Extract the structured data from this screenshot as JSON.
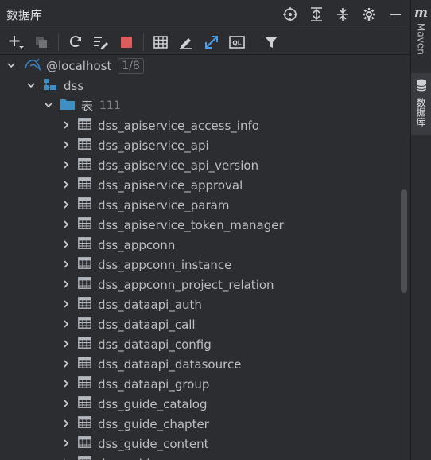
{
  "panel": {
    "title": "数据库"
  },
  "icons": {
    "locate": "crosshair-icon",
    "expand_all": "expand-all-icon",
    "collapse_all": "collapse-all-icon",
    "settings": "gear-icon",
    "minimize": "minimize-icon",
    "add": "plus-icon",
    "duplicate": "copy-icon",
    "refresh": "refresh-icon",
    "properties": "properties-icon",
    "stop": "stop-icon",
    "table": "table-icon",
    "edit": "edit-icon",
    "jump": "jump-icon",
    "console": "ql-console-icon",
    "filter": "filter-icon"
  },
  "colors": {
    "stop": "#db5c5c",
    "accent": "#3574f0",
    "folder": "#3d8fc4"
  },
  "tree": {
    "host": {
      "label": "@localhost",
      "badge": "1/8"
    },
    "schema": {
      "label": "dss"
    },
    "folder": {
      "label": "表",
      "count": "111"
    },
    "tables": [
      "dss_apiservice_access_info",
      "dss_apiservice_api",
      "dss_apiservice_api_version",
      "dss_apiservice_approval",
      "dss_apiservice_param",
      "dss_apiservice_token_manager",
      "dss_appconn",
      "dss_appconn_instance",
      "dss_appconn_project_relation",
      "dss_dataapi_auth",
      "dss_dataapi_call",
      "dss_dataapi_config",
      "dss_dataapi_datasource",
      "dss_dataapi_group",
      "dss_guide_catalog",
      "dss_guide_chapter",
      "dss_guide_content",
      "dss_guide_group"
    ]
  },
  "sidebar_right": {
    "maven": "Maven",
    "database": "数据库"
  }
}
